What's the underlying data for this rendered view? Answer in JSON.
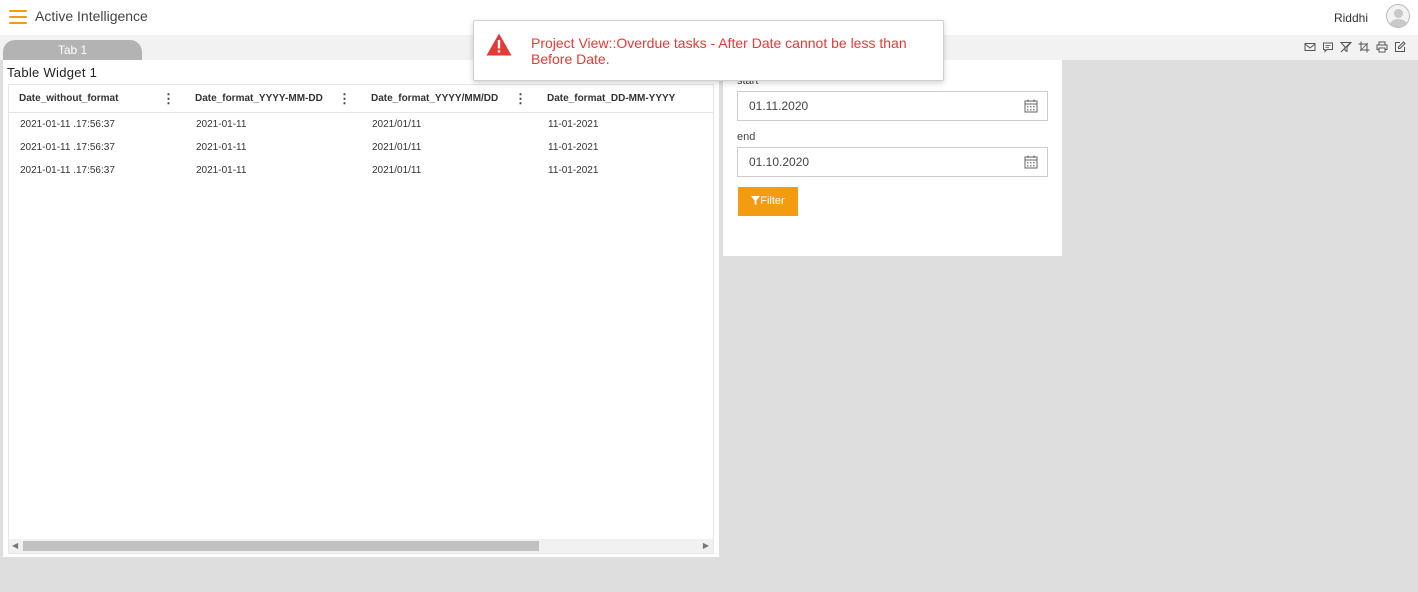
{
  "header": {
    "app_title": "Active Intelligence",
    "user_name": "Riddhi"
  },
  "tabs": [
    {
      "label": "Tab 1",
      "active": true
    }
  ],
  "toolbar_icons": [
    "mail-icon",
    "comment-icon",
    "clear-filter-icon",
    "crop-icon",
    "print-icon",
    "edit-icon"
  ],
  "table_widget": {
    "title": "Table Widget 1",
    "columns": [
      "Date_without_format",
      "Date_format_YYYY-MM-DD",
      "Date_format_YYYY/MM/DD",
      "Date_format_DD-MM-YYYY"
    ],
    "rows": [
      [
        "2021-01-11 .17:56:37",
        "2021-01-11",
        "2021/01/11",
        "11-01-2021"
      ],
      [
        "2021-01-11 .17:56:37",
        "2021-01-11",
        "2021/01/11",
        "11-01-2021"
      ],
      [
        "2021-01-11 .17:56:37",
        "2021-01-11",
        "2021/01/11",
        "11-01-2021"
      ]
    ]
  },
  "filter_widget": {
    "start_label": "start",
    "start_value": "01.11.2020",
    "end_label": "end",
    "end_value": "01.10.2020",
    "filter_button_label": "Filter"
  },
  "notification": {
    "type": "error",
    "message": "Project View::Overdue tasks - After Date cannot be less than Before Date."
  },
  "colors": {
    "accent": "#f39c12",
    "error": "#e53935",
    "tab": "#b3b3b3",
    "canvas": "#dedede"
  }
}
